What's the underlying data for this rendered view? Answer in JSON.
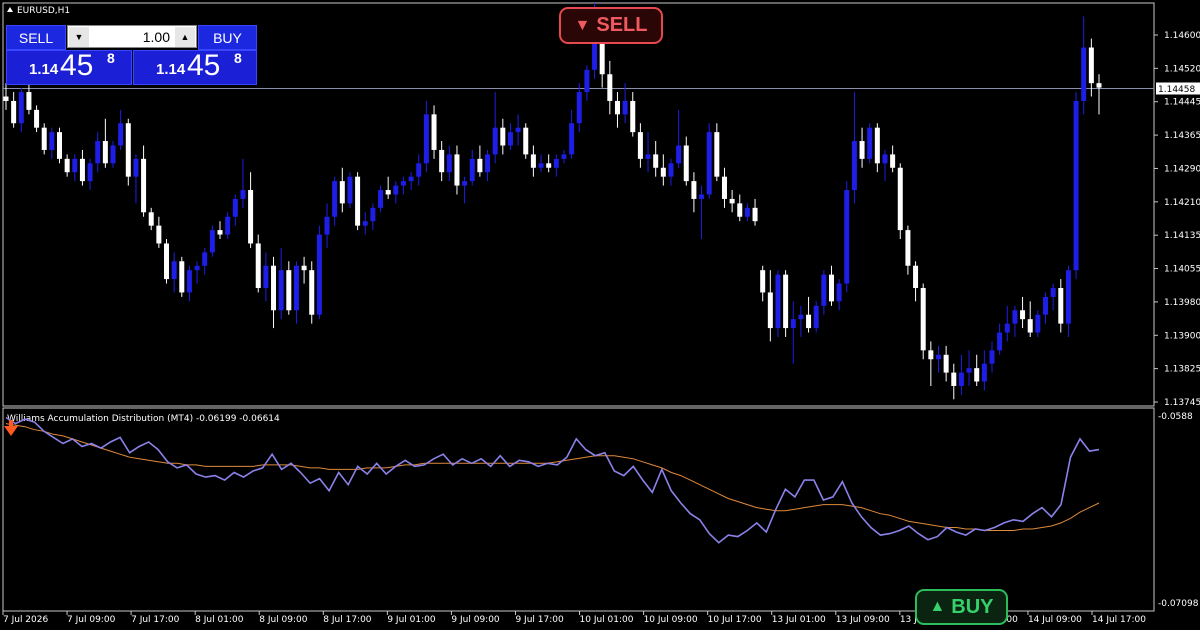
{
  "chart": {
    "symbol_label": "EURUSD,H1",
    "current_price_label": "1.14458",
    "price_axis_labels": [
      "1.14600",
      "1.14520",
      "1.14445",
      "1.14365",
      "1.14290",
      "1.14210",
      "1.14135",
      "1.14055",
      "1.13980",
      "1.13900",
      "1.13825",
      "1.13745"
    ],
    "time_axis_labels": [
      "7 Jul 2026",
      "7 Jul 09:00",
      "7 Jul 17:00",
      "8 Jul 01:00",
      "8 Jul 09:00",
      "8 Jul 17:00",
      "9 Jul 01:00",
      "9 Jul 09:00",
      "9 Jul 17:00",
      "10 Jul 01:00",
      "10 Jul 09:00",
      "10 Jul 17:00",
      "13 Jul 01:00",
      "13 Jul 09:00",
      "13 Jul 17:00",
      "14 Jul 01:00",
      "14 Jul 09:00",
      "14 Jul 17:00"
    ],
    "colors": {
      "bull": "#1e1ee6",
      "bear": "#ffffff",
      "wad_line": "#8a82e8",
      "wad_ma": "#e08a3c",
      "grid": "#ffffff"
    }
  },
  "indicator": {
    "label": "Williams Accumulation Distribution (MT4) -0.06199 -0.06614",
    "axis_top": "-0.0588",
    "axis_bottom": "-0.07098"
  },
  "trade_panel": {
    "sell_label": "SELL",
    "buy_label": "BUY",
    "lot_value": "1.00",
    "bid": {
      "small": "1.14",
      "big": "45",
      "sup": "8"
    },
    "ask": {
      "small": "1.14",
      "big": "45",
      "sup": "8"
    }
  },
  "signals": {
    "sell_label": "SELL",
    "sell_arrow": "▼",
    "buy_label": "BUY",
    "buy_arrow": "▲"
  },
  "chart_data": {
    "type": "candlestick",
    "ylim": [
      1.13745,
      1.1465
    ],
    "candles": [
      [
        1.1444,
        1.1447,
        1.1441,
        1.1443
      ],
      [
        1.1443,
        1.1445,
        1.1437,
        1.1438
      ],
      [
        1.1438,
        1.1446,
        1.1436,
        1.1445
      ],
      [
        1.1445,
        1.1447,
        1.144,
        1.1441
      ],
      [
        1.1441,
        1.1442,
        1.1436,
        1.1437
      ],
      [
        1.1437,
        1.1438,
        1.1431,
        1.1432
      ],
      [
        1.1432,
        1.1437,
        1.143,
        1.1436
      ],
      [
        1.1436,
        1.1437,
        1.1429,
        1.143
      ],
      [
        1.143,
        1.1431,
        1.1426,
        1.1427
      ],
      [
        1.1427,
        1.1431,
        1.1425,
        1.143
      ],
      [
        1.143,
        1.1432,
        1.1424,
        1.1425
      ],
      [
        1.1425,
        1.143,
        1.1423,
        1.1429
      ],
      [
        1.1429,
        1.1436,
        1.1427,
        1.1434
      ],
      [
        1.1434,
        1.1439,
        1.1428,
        1.1429
      ],
      [
        1.1429,
        1.1434,
        1.1428,
        1.1433
      ],
      [
        1.1433,
        1.1441,
        1.1432,
        1.1438
      ],
      [
        1.1438,
        1.1439,
        1.1424,
        1.1426
      ],
      [
        1.1426,
        1.1431,
        1.142,
        1.143
      ],
      [
        1.143,
        1.1433,
        1.1417,
        1.1418
      ],
      [
        1.1418,
        1.1419,
        1.1414,
        1.1415
      ],
      [
        1.1415,
        1.1417,
        1.141,
        1.1411
      ],
      [
        1.1411,
        1.1412,
        1.1402,
        1.1403
      ],
      [
        1.1403,
        1.1409,
        1.14,
        1.1407
      ],
      [
        1.1407,
        1.1408,
        1.1399,
        1.14
      ],
      [
        1.14,
        1.1406,
        1.1398,
        1.1405
      ],
      [
        1.1405,
        1.1407,
        1.1402,
        1.1406
      ],
      [
        1.1406,
        1.141,
        1.1404,
        1.1409
      ],
      [
        1.1409,
        1.1415,
        1.1408,
        1.1414
      ],
      [
        1.1414,
        1.1416,
        1.1412,
        1.1413
      ],
      [
        1.1413,
        1.1418,
        1.1412,
        1.1417
      ],
      [
        1.1417,
        1.1422,
        1.1415,
        1.1421
      ],
      [
        1.1421,
        1.143,
        1.1419,
        1.1423
      ],
      [
        1.1423,
        1.1427,
        1.141,
        1.1411
      ],
      [
        1.1411,
        1.1413,
        1.14,
        1.1401
      ],
      [
        1.1401,
        1.1409,
        1.1398,
        1.1406
      ],
      [
        1.1406,
        1.1408,
        1.1392,
        1.1396
      ],
      [
        1.1396,
        1.141,
        1.1394,
        1.1405
      ],
      [
        1.1405,
        1.1407,
        1.1395,
        1.1396
      ],
      [
        1.1396,
        1.1407,
        1.1393,
        1.1406
      ],
      [
        1.1406,
        1.1408,
        1.1402,
        1.1405
      ],
      [
        1.1405,
        1.1407,
        1.1393,
        1.1395
      ],
      [
        1.1395,
        1.1415,
        1.1394,
        1.1413
      ],
      [
        1.1413,
        1.142,
        1.141,
        1.1417
      ],
      [
        1.1417,
        1.1426,
        1.1415,
        1.1425
      ],
      [
        1.1425,
        1.1428,
        1.1418,
        1.142
      ],
      [
        1.142,
        1.1427,
        1.1419,
        1.1426
      ],
      [
        1.1426,
        1.1427,
        1.1414,
        1.1415
      ],
      [
        1.1415,
        1.1418,
        1.1413,
        1.1416
      ],
      [
        1.1416,
        1.142,
        1.1414,
        1.1419
      ],
      [
        1.1419,
        1.1424,
        1.1418,
        1.1423
      ],
      [
        1.1423,
        1.1426,
        1.1421,
        1.1422
      ],
      [
        1.1422,
        1.1425,
        1.142,
        1.1424
      ],
      [
        1.1424,
        1.1426,
        1.1422,
        1.1425
      ],
      [
        1.1425,
        1.1427,
        1.1423,
        1.1426
      ],
      [
        1.1426,
        1.1431,
        1.1424,
        1.1429
      ],
      [
        1.1429,
        1.1443,
        1.1427,
        1.144
      ],
      [
        1.144,
        1.1442,
        1.143,
        1.1432
      ],
      [
        1.1432,
        1.1434,
        1.1425,
        1.1427
      ],
      [
        1.1427,
        1.1433,
        1.1425,
        1.1431
      ],
      [
        1.1431,
        1.1433,
        1.1422,
        1.1424
      ],
      [
        1.1424,
        1.1426,
        1.142,
        1.1425
      ],
      [
        1.1425,
        1.1432,
        1.1424,
        1.143
      ],
      [
        1.143,
        1.1433,
        1.1426,
        1.1427
      ],
      [
        1.1427,
        1.1432,
        1.1425,
        1.1431
      ],
      [
        1.1431,
        1.1445,
        1.1429,
        1.1437
      ],
      [
        1.1437,
        1.1439,
        1.1431,
        1.1433
      ],
      [
        1.1433,
        1.1438,
        1.1432,
        1.1436
      ],
      [
        1.1436,
        1.144,
        1.1433,
        1.1437
      ],
      [
        1.1437,
        1.1438,
        1.143,
        1.1431
      ],
      [
        1.1431,
        1.1433,
        1.1426,
        1.1428
      ],
      [
        1.1428,
        1.1431,
        1.1427,
        1.1429
      ],
      [
        1.1429,
        1.1431,
        1.1427,
        1.1428
      ],
      [
        1.1428,
        1.1431,
        1.1426,
        1.143
      ],
      [
        1.143,
        1.1432,
        1.1429,
        1.1431
      ],
      [
        1.1431,
        1.1441,
        1.143,
        1.1438
      ],
      [
        1.1438,
        1.1447,
        1.1436,
        1.1445
      ],
      [
        1.1445,
        1.1451,
        1.1443,
        1.145
      ],
      [
        1.145,
        1.1465,
        1.1448,
        1.146
      ],
      [
        1.146,
        1.1464,
        1.1446,
        1.1449
      ],
      [
        1.1449,
        1.1452,
        1.144,
        1.1443
      ],
      [
        1.1443,
        1.1445,
        1.1437,
        1.144
      ],
      [
        1.144,
        1.1447,
        1.1438,
        1.1443
      ],
      [
        1.1443,
        1.1445,
        1.1435,
        1.1436
      ],
      [
        1.1436,
        1.1438,
        1.1428,
        1.143
      ],
      [
        1.143,
        1.1436,
        1.1427,
        1.1431
      ],
      [
        1.1431,
        1.1434,
        1.1426,
        1.1428
      ],
      [
        1.1428,
        1.1431,
        1.1424,
        1.1426
      ],
      [
        1.1426,
        1.143,
        1.1424,
        1.1429
      ],
      [
        1.1429,
        1.1441,
        1.1428,
        1.1433
      ],
      [
        1.1433,
        1.1435,
        1.1424,
        1.1425
      ],
      [
        1.1425,
        1.1427,
        1.1418,
        1.1421
      ],
      [
        1.1421,
        1.1424,
        1.1412,
        1.1422
      ],
      [
        1.1422,
        1.1438,
        1.1421,
        1.1436
      ],
      [
        1.1436,
        1.1438,
        1.1425,
        1.1426
      ],
      [
        1.1426,
        1.1428,
        1.1419,
        1.1421
      ],
      [
        1.1421,
        1.1423,
        1.1418,
        1.142
      ],
      [
        1.142,
        1.1422,
        1.1416,
        1.1417
      ],
      [
        1.1417,
        1.142,
        1.1416,
        1.1419
      ],
      [
        1.1419,
        1.1421,
        1.1415,
        1.1416
      ],
      [
        1.1405,
        1.1406,
        1.1398,
        1.14
      ],
      [
        1.14,
        1.1405,
        1.1389,
        1.1392
      ],
      [
        1.1392,
        1.1405,
        1.139,
        1.1404
      ],
      [
        1.1404,
        1.1405,
        1.139,
        1.1392
      ],
      [
        1.1392,
        1.1398,
        1.1384,
        1.1394
      ],
      [
        1.1394,
        1.1397,
        1.139,
        1.1395
      ],
      [
        1.1395,
        1.1399,
        1.1391,
        1.1392
      ],
      [
        1.1392,
        1.1398,
        1.1391,
        1.1397
      ],
      [
        1.1397,
        1.1405,
        1.1395,
        1.1404
      ],
      [
        1.1404,
        1.1406,
        1.1397,
        1.1398
      ],
      [
        1.1398,
        1.1403,
        1.1396,
        1.1402
      ],
      [
        1.1402,
        1.1425,
        1.14,
        1.1423
      ],
      [
        1.1423,
        1.1445,
        1.142,
        1.1434
      ],
      [
        1.1434,
        1.1437,
        1.1428,
        1.143
      ],
      [
        1.143,
        1.1438,
        1.1429,
        1.1437
      ],
      [
        1.1437,
        1.1438,
        1.1427,
        1.1429
      ],
      [
        1.1429,
        1.1432,
        1.1425,
        1.1431
      ],
      [
        1.1431,
        1.1433,
        1.1427,
        1.1428
      ],
      [
        1.1428,
        1.1429,
        1.1412,
        1.1414
      ],
      [
        1.1414,
        1.1415,
        1.1404,
        1.1406
      ],
      [
        1.1406,
        1.1407,
        1.1398,
        1.1401
      ],
      [
        1.1401,
        1.1402,
        1.1385,
        1.1387
      ],
      [
        1.1387,
        1.1389,
        1.1379,
        1.1385
      ],
      [
        1.1385,
        1.1388,
        1.1382,
        1.1386
      ],
      [
        1.1386,
        1.1388,
        1.138,
        1.1382
      ],
      [
        1.1382,
        1.1384,
        1.1376,
        1.1379
      ],
      [
        1.1379,
        1.1386,
        1.1377,
        1.1382
      ],
      [
        1.1382,
        1.1387,
        1.1379,
        1.1383
      ],
      [
        1.1383,
        1.1386,
        1.1379,
        1.138
      ],
      [
        1.138,
        1.1387,
        1.1378,
        1.1384
      ],
      [
        1.1384,
        1.1389,
        1.1382,
        1.1387
      ],
      [
        1.1387,
        1.1393,
        1.1386,
        1.1391
      ],
      [
        1.1391,
        1.1397,
        1.1389,
        1.1393
      ],
      [
        1.1393,
        1.1397,
        1.139,
        1.1396
      ],
      [
        1.1396,
        1.1399,
        1.1392,
        1.1394
      ],
      [
        1.1394,
        1.1398,
        1.139,
        1.1391
      ],
      [
        1.1391,
        1.1396,
        1.139,
        1.1395
      ],
      [
        1.1395,
        1.14,
        1.1393,
        1.1399
      ],
      [
        1.1399,
        1.1402,
        1.1396,
        1.1401
      ],
      [
        1.1401,
        1.1403,
        1.1391,
        1.1393
      ],
      [
        1.1393,
        1.1406,
        1.139,
        1.1405
      ],
      [
        1.1405,
        1.1445,
        1.1403,
        1.1443
      ],
      [
        1.1443,
        1.1462,
        1.144,
        1.1455
      ],
      [
        1.1455,
        1.1457,
        1.1444,
        1.1447
      ],
      [
        1.1447,
        1.1449,
        1.144,
        1.1446
      ]
    ],
    "wad": [
      -0.0589,
      -0.0593,
      -0.059,
      -0.0592,
      -0.0598,
      -0.0602,
      -0.0606,
      -0.0603,
      -0.0608,
      -0.0606,
      -0.0609,
      -0.0605,
      -0.0602,
      -0.0612,
      -0.0608,
      -0.0605,
      -0.061,
      -0.0618,
      -0.0622,
      -0.062,
      -0.0626,
      -0.0628,
      -0.0627,
      -0.063,
      -0.0625,
      -0.0628,
      -0.0624,
      -0.0622,
      -0.0613,
      -0.0623,
      -0.0619,
      -0.0625,
      -0.0632,
      -0.0629,
      -0.0637,
      -0.0625,
      -0.0633,
      -0.0621,
      -0.0626,
      -0.0619,
      -0.0626,
      -0.0621,
      -0.0617,
      -0.0621,
      -0.062,
      -0.0616,
      -0.0613,
      -0.062,
      -0.0616,
      -0.0619,
      -0.0616,
      -0.0621,
      -0.0614,
      -0.0621,
      -0.0617,
      -0.0618,
      -0.0621,
      -0.0619,
      -0.062,
      -0.0615,
      -0.0603,
      -0.061,
      -0.0614,
      -0.0612,
      -0.0624,
      -0.0627,
      -0.0621,
      -0.063,
      -0.0638,
      -0.0623,
      -0.0637,
      -0.0645,
      -0.0652,
      -0.0656,
      -0.0665,
      -0.0671,
      -0.0666,
      -0.0667,
      -0.0663,
      -0.0658,
      -0.0664,
      -0.0649,
      -0.0636,
      -0.0641,
      -0.063,
      -0.063,
      -0.0643,
      -0.0641,
      -0.0631,
      -0.0645,
      -0.0654,
      -0.0661,
      -0.0666,
      -0.0665,
      -0.0663,
      -0.066,
      -0.0665,
      -0.0669,
      -0.0667,
      -0.0661,
      -0.0664,
      -0.0666,
      -0.0662,
      -0.0663,
      -0.0661,
      -0.0658,
      -0.0656,
      -0.0657,
      -0.0652,
      -0.0648,
      -0.0654,
      -0.0646,
      -0.0615,
      -0.0603,
      -0.0611,
      -0.061
    ],
    "wad_ma": [
      -0.0593,
      -0.0594,
      -0.0595,
      -0.0597,
      -0.0598,
      -0.06,
      -0.0601,
      -0.0603,
      -0.0605,
      -0.0607,
      -0.0609,
      -0.0611,
      -0.0613,
      -0.0615,
      -0.0616,
      -0.0617,
      -0.0618,
      -0.0619,
      -0.0619,
      -0.062,
      -0.062,
      -0.0621,
      -0.0621,
      -0.0621,
      -0.0621,
      -0.0621,
      -0.0621,
      -0.062,
      -0.062,
      -0.062,
      -0.062,
      -0.0621,
      -0.0622,
      -0.0622,
      -0.0623,
      -0.0623,
      -0.0623,
      -0.0623,
      -0.0622,
      -0.0622,
      -0.0622,
      -0.0621,
      -0.062,
      -0.062,
      -0.0619,
      -0.0619,
      -0.0619,
      -0.0619,
      -0.0619,
      -0.0619,
      -0.0619,
      -0.0619,
      -0.0619,
      -0.0619,
      -0.0619,
      -0.0619,
      -0.0619,
      -0.0619,
      -0.0618,
      -0.0617,
      -0.0616,
      -0.0615,
      -0.0614,
      -0.0614,
      -0.0614,
      -0.0615,
      -0.0616,
      -0.0618,
      -0.062,
      -0.0622,
      -0.0625,
      -0.0627,
      -0.063,
      -0.0633,
      -0.0636,
      -0.0639,
      -0.0642,
      -0.0644,
      -0.0646,
      -0.0648,
      -0.0649,
      -0.065,
      -0.065,
      -0.0649,
      -0.0648,
      -0.0647,
      -0.0646,
      -0.0646,
      -0.0646,
      -0.0647,
      -0.0648,
      -0.065,
      -0.0652,
      -0.0653,
      -0.0655,
      -0.0657,
      -0.0658,
      -0.0659,
      -0.066,
      -0.0661,
      -0.0661,
      -0.0662,
      -0.0662,
      -0.0663,
      -0.0663,
      -0.0663,
      -0.0663,
      -0.0662,
      -0.0662,
      -0.0661,
      -0.066,
      -0.0658,
      -0.0655,
      -0.0651,
      -0.0648,
      -0.0645
    ],
    "wad_ylim": [
      -0.07098,
      -0.0588
    ]
  }
}
